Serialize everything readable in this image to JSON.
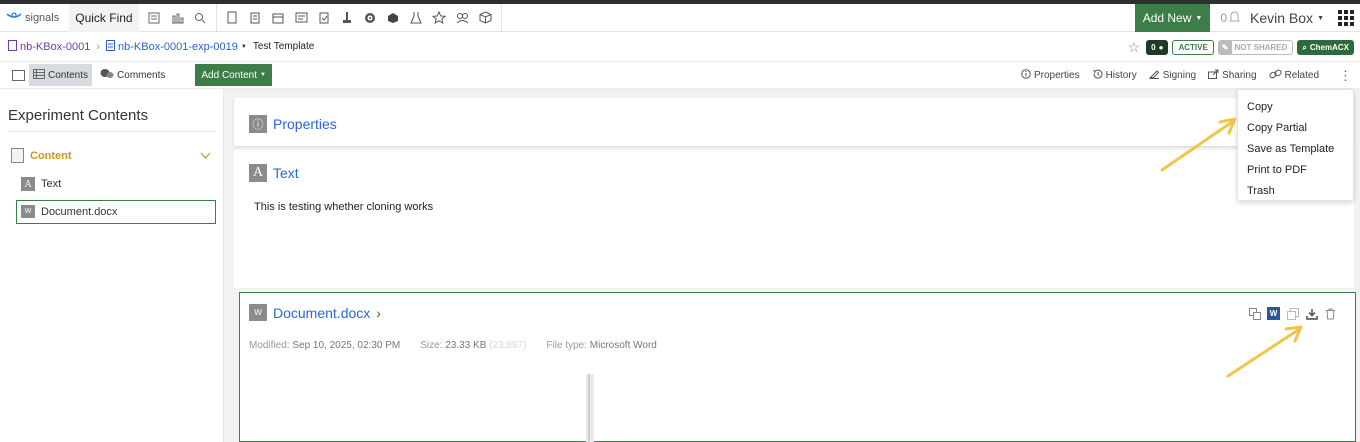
{
  "topnav": {
    "logo_text": "signals",
    "quickfind_label": "Quick Find",
    "icons": [
      "calculator-icon",
      "chart-icon",
      "search-icon",
      "notebook-icon",
      "clipboard-icon",
      "calendar-icon",
      "image-icon",
      "clipboard-check-icon",
      "flask-stand-icon",
      "target-icon",
      "cube-icon",
      "beaker-icon",
      "star-icon",
      "molecule-icon",
      "box-icon"
    ],
    "add_new_label": "Add New",
    "notification_count": "0",
    "user_name": "Kevin Box"
  },
  "breadcrumb": {
    "notebook": "nb-KBox-0001",
    "experiment": "nb-KBox-0001-exp-0019",
    "title": "Test Template",
    "comment_count": "0",
    "status": "ACTIVE",
    "sharing": "NOT SHARED",
    "chem_label": "ChemACX"
  },
  "toolbar": {
    "contents_label": "Contents",
    "comments_label": "Comments",
    "add_content_label": "Add Content",
    "right_items": [
      "Properties",
      "History",
      "Signing",
      "Sharing",
      "Related"
    ]
  },
  "left_panel": {
    "title": "Experiment Contents",
    "section_label": "Content",
    "items": [
      "Text",
      "Document.docx"
    ]
  },
  "main": {
    "properties_heading": "Properties",
    "text_heading": "Text",
    "text_body": "This is testing whether cloning works",
    "doc_heading": "Document.docx",
    "meta": {
      "modified_label": "Modified:",
      "modified_value": "Sep 10, 2025, 02:30 PM",
      "size_label": "Size:",
      "size_value": "23.33 KB",
      "size_bytes": "(23,887)",
      "filetype_label": "File type:",
      "filetype_value": "Microsoft Word"
    }
  },
  "dropdown": {
    "items": [
      "Copy",
      "Copy Partial",
      "Save as Template",
      "Print to PDF",
      "Trash"
    ]
  },
  "colors": {
    "accent_green": "#3d7d48",
    "link_blue": "#2a66d8",
    "section_gold": "#c9971e",
    "arrow_yellow": "#f0c64a"
  }
}
